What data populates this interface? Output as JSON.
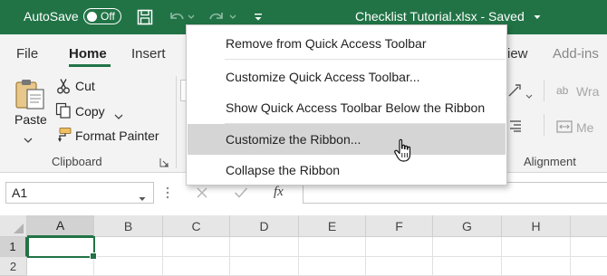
{
  "titlebar": {
    "autosave_label": "AutoSave",
    "autosave_state": "Off",
    "document_title": "Checklist Tutorial.xlsx  -  Saved",
    "bg_color": "#217346"
  },
  "tabs": [
    {
      "label": "File"
    },
    {
      "label": "Home",
      "active": true
    },
    {
      "label": "Insert"
    },
    {
      "label": "iew"
    },
    {
      "label": "Add-ins"
    }
  ],
  "ribbon": {
    "paste_label": "Paste",
    "cut_label": "Cut",
    "copy_label": "Copy",
    "format_painter_label": "Format Painter",
    "clipboard_group": "Clipboard",
    "alignment_group": "Alignment",
    "wrap_partial": "Wra",
    "merge_partial": "Me"
  },
  "formula_bar": {
    "name_box": "A1",
    "fx_label": "fx",
    "formula_value": ""
  },
  "grid": {
    "columns": [
      "A",
      "B",
      "C",
      "D",
      "E",
      "F",
      "G",
      "H"
    ],
    "rows": [
      "1",
      "2"
    ],
    "selected_cell": "A1"
  },
  "context_menu": {
    "items": [
      {
        "label": "Remove from Quick Access Toolbar",
        "hovered": false
      },
      {
        "label": "Customize Quick Access Toolbar...",
        "hovered": false
      },
      {
        "label": "Show Quick Access Toolbar Below the Ribbon",
        "hovered": false
      },
      {
        "label": "Customize the Ribbon...",
        "hovered": true
      },
      {
        "label": "Collapse the Ribbon",
        "hovered": false
      }
    ]
  }
}
